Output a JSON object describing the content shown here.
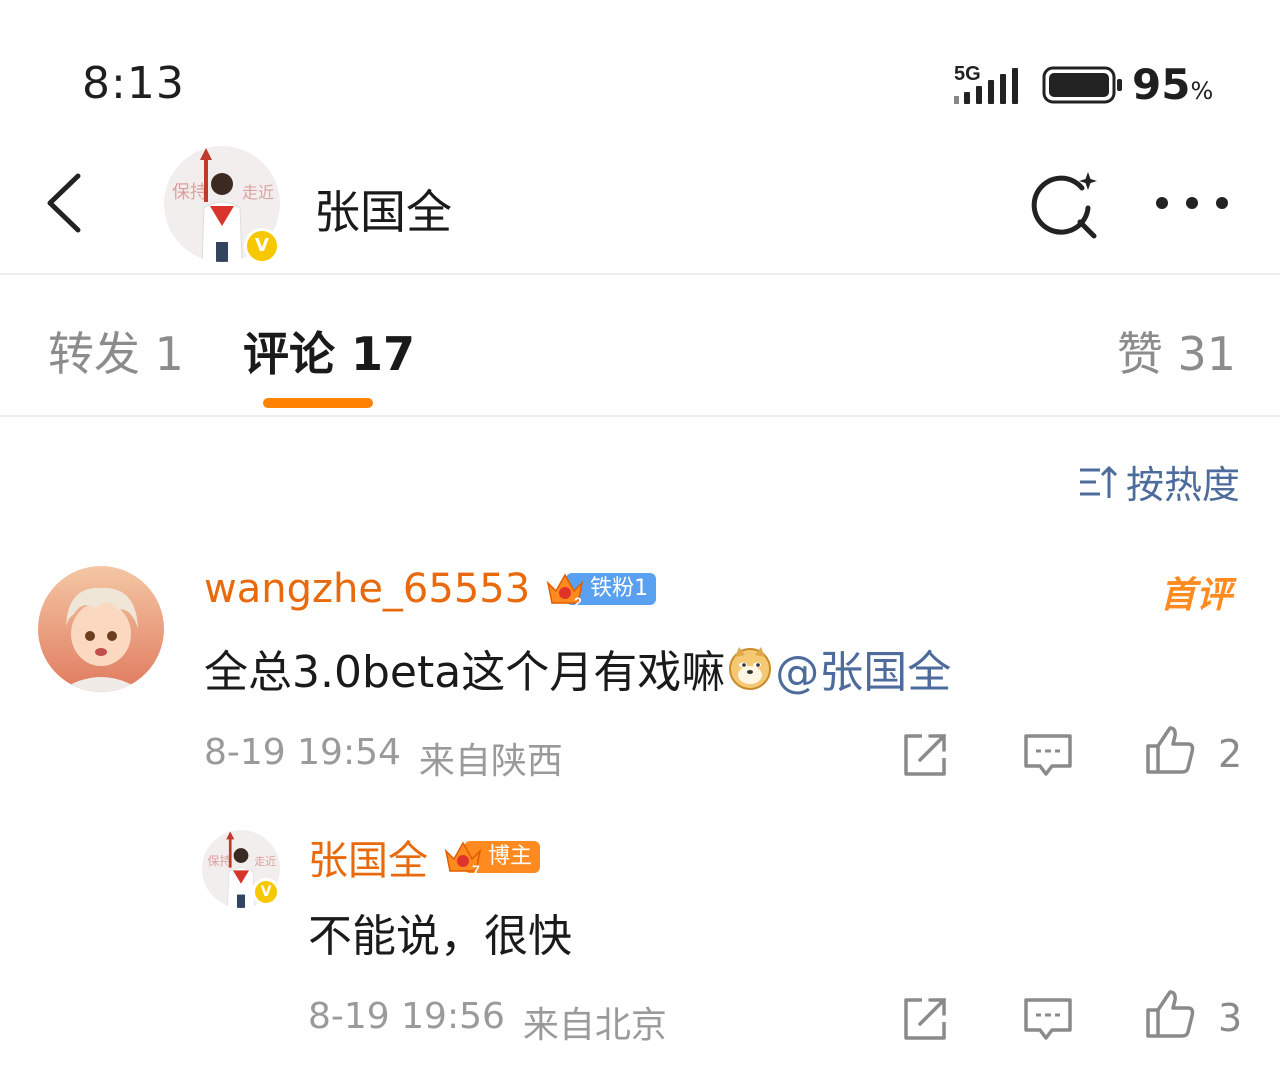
{
  "status_bar": {
    "time": "8:13",
    "network": "5G",
    "battery_percent": "95",
    "battery_unit": "%"
  },
  "header": {
    "name": "张国全",
    "verified_mark": "V"
  },
  "tabs": {
    "repost": "转发 1",
    "comments": "评论 17",
    "likes": "赞 31"
  },
  "sort": {
    "label": "按热度"
  },
  "comments": [
    {
      "username": "wangzhe_65553",
      "badge_label": "铁粉1",
      "badge_level": "2",
      "tag": "首评",
      "text_part1": "全总3.0beta这个月有戏嘛",
      "emoji": "doge-emoji",
      "mention": "@张国全",
      "date": "8-19 19:54",
      "location": "来自陕西",
      "likes": "2"
    },
    {
      "username": "张国全",
      "badge_label": "博主",
      "badge_level": "7",
      "text": "不能说，很快",
      "date": "8-19 19:56",
      "location": "来自北京",
      "likes": "3"
    }
  ],
  "colors": {
    "accent": "#ff8200",
    "username": "#e86a0c",
    "link": "#4d6c9c",
    "fan_badge": "#5aa0f0",
    "owner_badge": "#ff8a1f"
  }
}
